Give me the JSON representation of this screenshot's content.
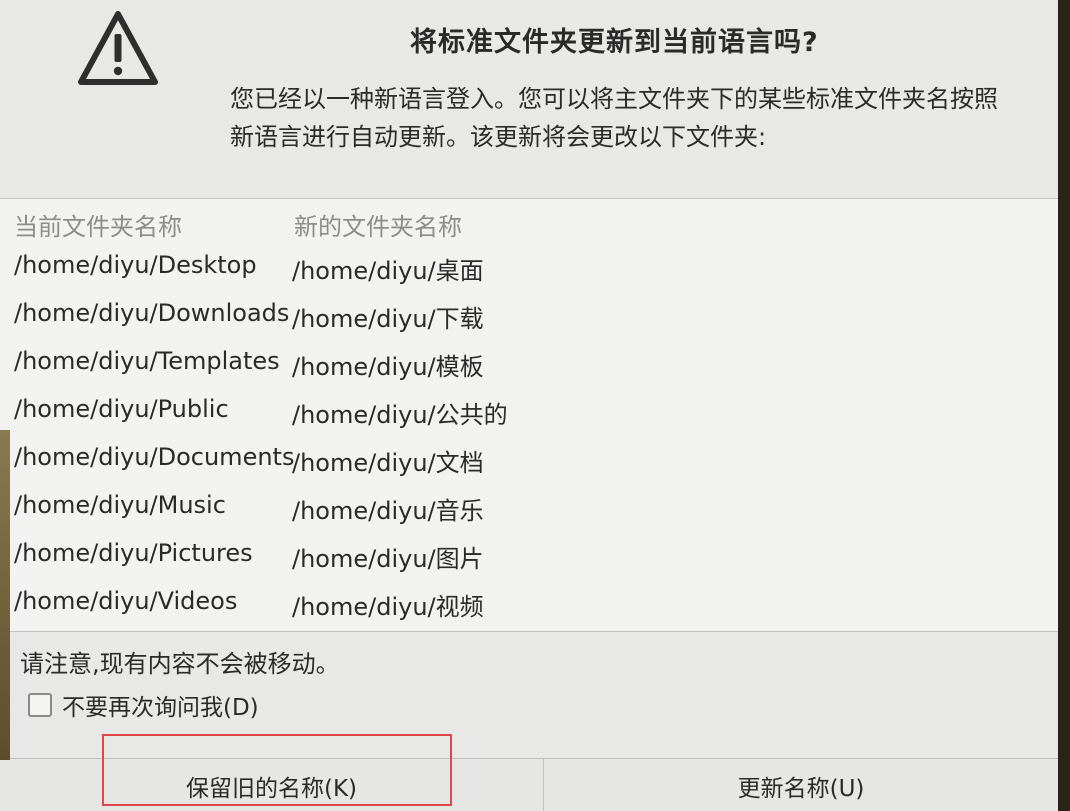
{
  "dialog": {
    "title": "将标准文件夹更新到当前语言吗?",
    "description_line1": "您已经以一种新语言登入。您可以将主文件夹下的某些标准文件夹名按照",
    "description_line2": "新语言进行自动更新。该更新将会更改以下文件夹:",
    "icon": "warning-icon"
  },
  "table": {
    "headers": {
      "current": "当前文件夹名称",
      "new": "新的文件夹名称"
    },
    "rows": [
      {
        "current": "/home/diyu/Desktop",
        "new": "/home/diyu/桌面"
      },
      {
        "current": "/home/diyu/Downloads",
        "new": "/home/diyu/下载"
      },
      {
        "current": "/home/diyu/Templates",
        "new": "/home/diyu/模板"
      },
      {
        "current": "/home/diyu/Public",
        "new": "/home/diyu/公共的"
      },
      {
        "current": "/home/diyu/Documents",
        "new": "/home/diyu/文档"
      },
      {
        "current": "/home/diyu/Music",
        "new": "/home/diyu/音乐"
      },
      {
        "current": "/home/diyu/Pictures",
        "new": "/home/diyu/图片"
      },
      {
        "current": "/home/diyu/Videos",
        "new": "/home/diyu/视频"
      }
    ]
  },
  "note": "请注意,现有内容不会被移动。",
  "checkbox": {
    "label": "不要再次询问我(D)",
    "checked": false
  },
  "buttons": {
    "keep": "保留旧的名称(K)",
    "update": "更新名称(U)"
  },
  "colors": {
    "highlight": "#e0464a",
    "dialog_bg": "#e8e8e6"
  }
}
